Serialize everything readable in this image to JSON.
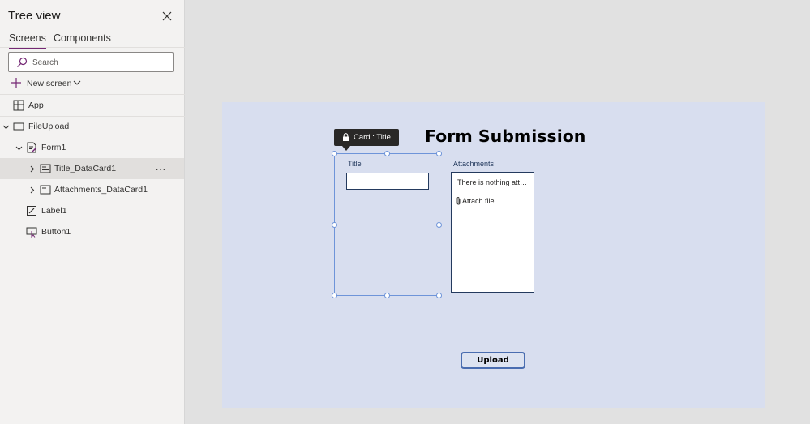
{
  "panel": {
    "title": "Tree view",
    "tabs": [
      {
        "label": "Screens",
        "active": true
      },
      {
        "label": "Components",
        "active": false
      }
    ],
    "search": {
      "placeholder": "Search",
      "value": ""
    },
    "new_screen_label": "New screen",
    "tree": [
      {
        "label": "App",
        "icon": "app-icon"
      },
      {
        "label": "FileUpload",
        "icon": "screen-icon",
        "expanded": true
      },
      {
        "label": "Form1",
        "icon": "form-icon",
        "expanded": true
      },
      {
        "label": "Title_DataCard1",
        "icon": "datacard-icon",
        "selected": true,
        "more": "..."
      },
      {
        "label": "Attachments_DataCard1",
        "icon": "datacard-icon"
      },
      {
        "label": "Label1",
        "icon": "label-icon"
      },
      {
        "label": "Button1",
        "icon": "button-icon"
      }
    ]
  },
  "canvas": {
    "form_title": "Form Submission",
    "tooltip": "Card : Title",
    "title_card": {
      "label": "Title",
      "value": ""
    },
    "attachments_card": {
      "label": "Attachments",
      "empty_text": "There is nothing attached.",
      "attach_label": "Attach file"
    },
    "upload_button": "Upload"
  },
  "colors": {
    "panel_bg": "#f3f2f1",
    "workspace_bg": "#e1e1e1",
    "canvas_bg": "#d8deef",
    "accent": "#742774",
    "selection": "#6e94d9",
    "button_border": "#4a6db0"
  }
}
